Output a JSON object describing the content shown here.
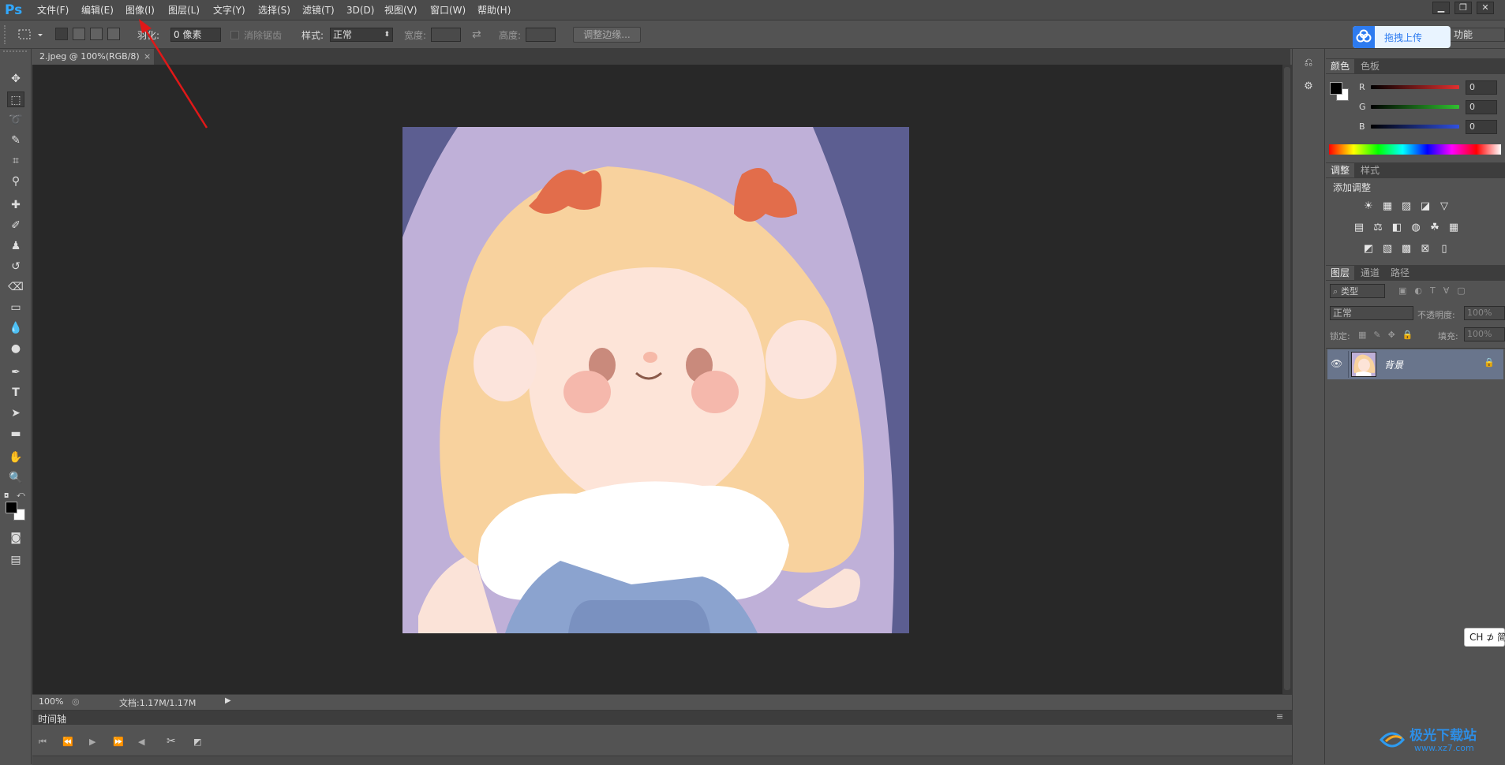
{
  "app": {
    "logo": "Ps"
  },
  "menu": [
    "文件(F)",
    "编辑(E)",
    "图像(I)",
    "图层(L)",
    "文字(Y)",
    "选择(S)",
    "滤镜(T)",
    "3D(D)",
    "视图(V)",
    "窗口(W)",
    "帮助(H)"
  ],
  "window_controls": [
    "▁",
    "❐",
    "✕"
  ],
  "options": {
    "feather_label": "羽化:",
    "feather_value": "0 像素",
    "antialias_label": "消除锯齿",
    "style_label": "样式:",
    "style_value": "正常",
    "width_label": "宽度:",
    "height_label": "高度:",
    "refine_edge_button": "调整边缘...",
    "workspace": "功能"
  },
  "baidu": {
    "upload_label": "拖拽上传"
  },
  "document_tab": {
    "title": "2.jpeg @ 100%(RGB/8)",
    "close": "×"
  },
  "status": {
    "zoom": "100%",
    "doc_size": "文档:1.17M/1.17M"
  },
  "timeline": {
    "title": "时间轴"
  },
  "color_panel": {
    "tabs": [
      "颜色",
      "色板"
    ],
    "channels": [
      {
        "label": "R",
        "value": "0",
        "color": "#e03030"
      },
      {
        "label": "G",
        "value": "0",
        "color": "#30c030"
      },
      {
        "label": "B",
        "value": "0",
        "color": "#3050e0"
      }
    ]
  },
  "adjustments_panel": {
    "tabs": [
      "调整",
      "样式"
    ],
    "title": "添加调整"
  },
  "layers_panel": {
    "tabs": [
      "图层",
      "通道",
      "路径"
    ],
    "filter_label": "类型",
    "blend_mode": "正常",
    "opacity_label": "不透明度:",
    "opacity_value": "100%",
    "lock_label": "锁定:",
    "fill_label": "填充:",
    "fill_value": "100%",
    "layers": [
      {
        "name": "背景"
      }
    ]
  },
  "ime": {
    "label": "CH ⊅ 简"
  },
  "watermark": {
    "text": "极光下载站",
    "url": "www.xz7.com"
  },
  "colors": {
    "accent": "#2d7bf0",
    "annotation_arrow": "#e01818",
    "canvas_bg": "#282828"
  }
}
